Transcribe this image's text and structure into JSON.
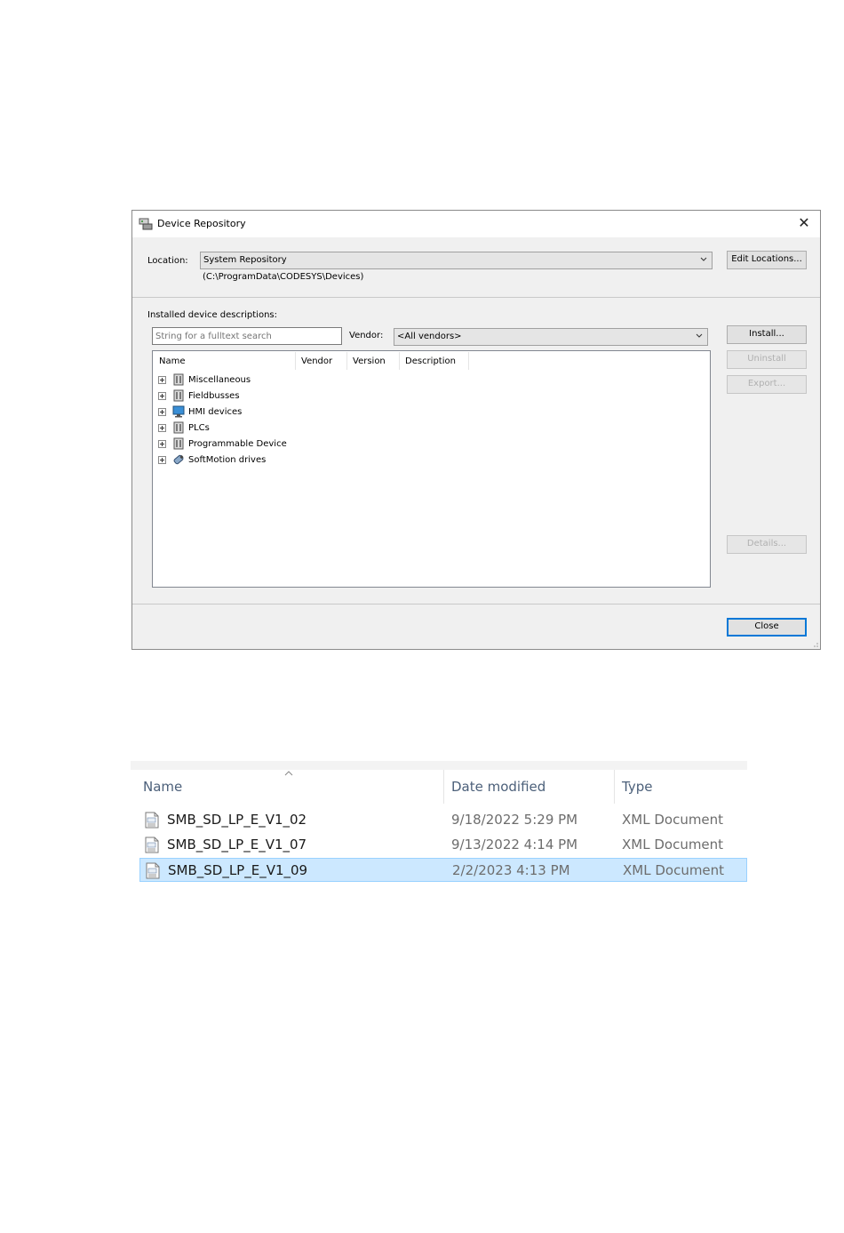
{
  "dialog": {
    "title": "Device Repository",
    "location_label": "Location:",
    "location_value": "System Repository",
    "location_path": "(C:\\ProgramData\\CODESYS\\Devices)",
    "edit_locations_label": "Edit Locations...",
    "installed_label": "Installed device descriptions:",
    "search_placeholder": "String for a fulltext search",
    "vendor_label": "Vendor:",
    "vendor_value": "<All vendors>",
    "install_label": "Install...",
    "uninstall_label": "Uninstall",
    "export_label": "Export...",
    "details_label": "Details...",
    "close_label": "Close",
    "columns": [
      "Name",
      "Vendor",
      "Version",
      "Description"
    ],
    "tree_items": [
      {
        "label": "Miscellaneous",
        "icon": "device-folder-icon"
      },
      {
        "label": "Fieldbusses",
        "icon": "device-folder-icon"
      },
      {
        "label": "HMI devices",
        "icon": "monitor-icon"
      },
      {
        "label": "PLCs",
        "icon": "device-folder-icon"
      },
      {
        "label": "Programmable Device",
        "icon": "device-folder-icon"
      },
      {
        "label": "SoftMotion drives",
        "icon": "drive-icon"
      }
    ]
  },
  "explorer": {
    "columns": [
      "Name",
      "Date modified",
      "Type"
    ],
    "files": [
      {
        "name": "SMB_SD_LP_E_V1_02",
        "date": "9/18/2022 5:29 PM",
        "type": "XML Document",
        "selected": false
      },
      {
        "name": "SMB_SD_LP_E_V1_07",
        "date": "9/13/2022 4:14 PM",
        "type": "XML Document",
        "selected": false
      },
      {
        "name": "SMB_SD_LP_E_V1_09",
        "date": "2/2/2023 4:13 PM",
        "type": "XML Document",
        "selected": true
      }
    ]
  },
  "colors": {
    "dialog_bg": "#f0f0f0",
    "accent": "#0078d7",
    "selection_bg": "#cce8ff",
    "selection_border": "#99d1ff"
  }
}
